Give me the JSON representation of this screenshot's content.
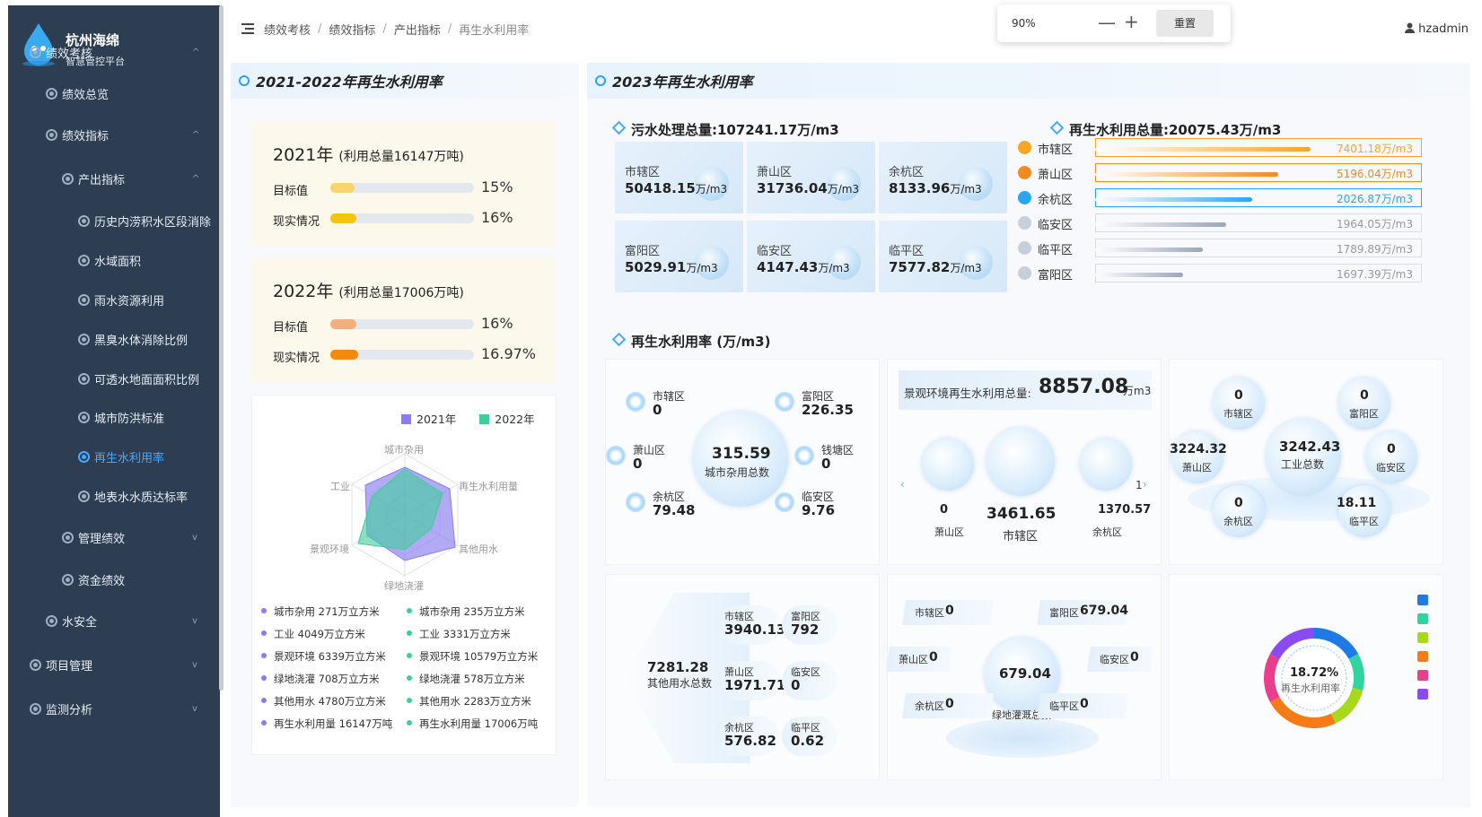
{
  "app": {
    "brand_title": "杭州海绵",
    "brand_subtitle": "智慧管控平台"
  },
  "sidebar": {
    "items": [
      {
        "label": "绩效考核",
        "chev": "^"
      },
      {
        "label": "绩效总览",
        "chev": ""
      },
      {
        "label": "绩效指标",
        "chev": "^"
      },
      {
        "label": "产出指标",
        "chev": "^"
      },
      {
        "label": "历史内涝积水区段消除",
        "chev": ""
      },
      {
        "label": "水域面积",
        "chev": ""
      },
      {
        "label": "雨水资源利用",
        "chev": ""
      },
      {
        "label": "黑臭水体消除比例",
        "chev": ""
      },
      {
        "label": "可透水地面面积比例",
        "chev": ""
      },
      {
        "label": "城市防洪标准",
        "chev": ""
      },
      {
        "label": "再生水利用率",
        "chev": ""
      },
      {
        "label": "地表水水质达标率",
        "chev": ""
      },
      {
        "label": "管理绩效",
        "chev": "v"
      },
      {
        "label": "资金绩效",
        "chev": ""
      },
      {
        "label": "水安全",
        "chev": "v"
      },
      {
        "label": "项目管理",
        "chev": "v"
      },
      {
        "label": "监测分析",
        "chev": "v"
      }
    ]
  },
  "breadcrumb": [
    "绩效考核",
    "绩效指标",
    "产出指标",
    "再生水利用率"
  ],
  "zoom": {
    "value": "90%",
    "minus": "—",
    "plus": "+",
    "reset": "重置"
  },
  "user": {
    "name": "hzadmin"
  },
  "left_panel": {
    "title": "2021-2022年再生水利用率",
    "y2021": {
      "title": "2021年",
      "subtitle": "(利用总量16147万吨)",
      "target_label": "目标值",
      "target_pct": "15%",
      "target_value": 0.15,
      "actual_label": "现实情况",
      "actual_pct": "16%",
      "actual_value": 0.16
    },
    "y2022": {
      "title": "2022年",
      "subtitle": "(利用总量17006万吨)",
      "target_label": "目标值",
      "target_pct": "16%",
      "target_value": 0.16,
      "actual_label": "现实情况",
      "actual_pct": "16.97%",
      "actual_value": 0.1697
    },
    "legend": [
      "2021年",
      "2022年"
    ],
    "radar_axes": [
      "城市杂用",
      "再生水利用量",
      "其他用水",
      "绿地浇灌",
      "景观环境",
      "工业"
    ],
    "list_2021": [
      "城市杂用 271万立方米",
      "工业 4049万立方米",
      "景观环境 6339万立方米",
      "绿地浇灌 708万立方米",
      "其他用水 4780万立方米",
      "再生水利用量 16147万吨"
    ],
    "list_2022": [
      "城市杂用 235万立方米",
      "工业 3331万立方米",
      "景观环境 10579万立方米",
      "绿地浇灌 578万立方米",
      "其他用水 2283万立方米",
      "再生水利用量 17006万吨"
    ],
    "colors": {
      "y2021": "#8b7cf0",
      "y2022": "#3ccf9a"
    }
  },
  "right_panel": {
    "title": "2023年再生水利用率",
    "sewage_title": "污水处理总量:107241.17万/m3",
    "sewage_tiles": [
      {
        "name": "市辖区",
        "value": "50418.15",
        "unit": "万/m3"
      },
      {
        "name": "萧山区",
        "value": "31736.04",
        "unit": "万/m3"
      },
      {
        "name": "余杭区",
        "value": "8133.96",
        "unit": "万/m3"
      },
      {
        "name": "富阳区",
        "value": "5029.91",
        "unit": "万/m3"
      },
      {
        "name": "临安区",
        "value": "4147.43",
        "unit": "万/m3"
      },
      {
        "name": "临平区",
        "value": "7577.82",
        "unit": "万/m3"
      }
    ],
    "reuse_title": "再生水利用总量:20075.43万/m3",
    "ranking": [
      {
        "name": "市辖区",
        "value": "7401.18",
        "unit": "万/m3",
        "ratio": 0.66,
        "color": "#f5a623"
      },
      {
        "name": "萧山区",
        "value": "5196.04",
        "unit": "万/m3",
        "ratio": 0.56,
        "color": "#f08a24"
      },
      {
        "name": "余杭区",
        "value": "2026.87",
        "unit": "万/m3",
        "ratio": 0.48,
        "color": "#2aa6ee"
      },
      {
        "name": "临安区",
        "value": "1964.05",
        "unit": "万/m3",
        "ratio": 0.4,
        "color": "#9aa6b8"
      },
      {
        "name": "临平区",
        "value": "1789.89",
        "unit": "万/m3",
        "ratio": 0.33,
        "color": "#9aa6b8"
      },
      {
        "name": "富阳区",
        "value": "1697.39",
        "unit": "万/m3",
        "ratio": 0.27,
        "color": "#9aa6b8"
      }
    ],
    "rate_title": "再生水利用率 (万/m3)",
    "urban": {
      "center_value": "315.59",
      "center_label": "城市杂用总数",
      "items": [
        {
          "name": "市辖区",
          "value": "0"
        },
        {
          "name": "富阳区",
          "value": "226.35"
        },
        {
          "name": "萧山区",
          "value": "0"
        },
        {
          "name": "钱塘区",
          "value": "0"
        },
        {
          "name": "余杭区",
          "value": "79.48"
        },
        {
          "name": "临安区",
          "value": "9.76"
        }
      ]
    },
    "landscape": {
      "label": "景观环境再生水利用总量:",
      "value": "8857.08",
      "unit": "万m3",
      "items": [
        {
          "name": "萧山区",
          "value": "0"
        },
        {
          "name": "市辖区",
          "value": "3461.65"
        },
        {
          "name": "余杭区",
          "value": "1370.57"
        }
      ],
      "edge_digit": "1"
    },
    "industry": {
      "center_value": "3242.43",
      "center_label": "工业总数",
      "items": [
        {
          "name": "市辖区",
          "value": "0"
        },
        {
          "name": "富阳区",
          "value": "0"
        },
        {
          "name": "萧山区",
          "value": "3224.32"
        },
        {
          "name": "临安区",
          "value": "0"
        },
        {
          "name": "余杭区",
          "value": "0"
        },
        {
          "name": "临平区",
          "value": "18.11"
        }
      ]
    },
    "other": {
      "center_value": "7281.28",
      "center_label": "其他用水总数",
      "items": [
        {
          "name": "市辖区",
          "value": "3940.13"
        },
        {
          "name": "富阳区",
          "value": "792"
        },
        {
          "name": "萧山区",
          "value": "1971.71"
        },
        {
          "name": "临安区",
          "value": "0"
        },
        {
          "name": "余杭区",
          "value": "576.82"
        },
        {
          "name": "临平区",
          "value": "0.62"
        }
      ]
    },
    "green": {
      "center_value": "679.04",
      "center_label": "绿地灌溉总数",
      "items": [
        {
          "name": "市辖区",
          "value": "0"
        },
        {
          "name": "富阳区",
          "value": "679.04"
        },
        {
          "name": "萧山区",
          "value": "0"
        },
        {
          "name": "临安区",
          "value": "0"
        },
        {
          "name": "余杭区",
          "value": "0"
        },
        {
          "name": "临平区",
          "value": "0"
        }
      ]
    },
    "donut": {
      "value": "18.72%",
      "label": "再生水利用率",
      "segment_colors": [
        "#1e7be5",
        "#2fd4a2",
        "#a8d81b",
        "#f47b16",
        "#e83e8c",
        "#8a4cf0"
      ],
      "segment_fractions": [
        0.17,
        0.12,
        0.14,
        0.24,
        0.16,
        0.17
      ]
    }
  }
}
